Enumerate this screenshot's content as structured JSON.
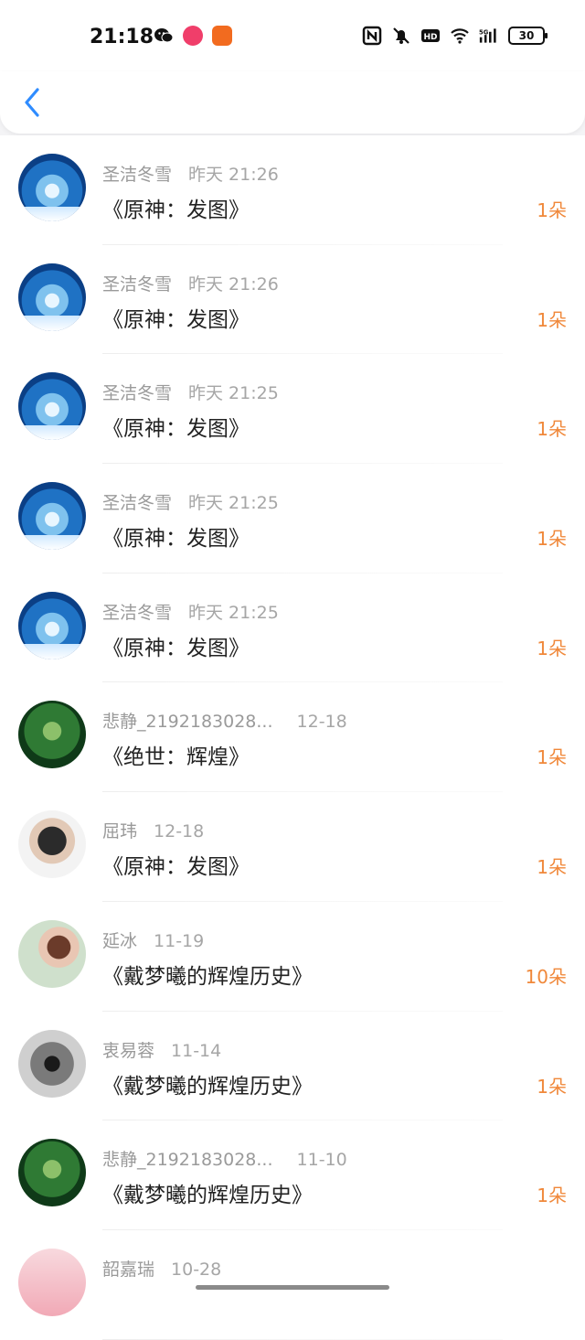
{
  "status_bar": {
    "time": "21:18",
    "app_icons": [
      "wechat-icon",
      "social-app-icon",
      "video-app-icon"
    ],
    "system_icons": [
      "nfc-icon",
      "mute-icon",
      "hd-icon",
      "wifi-icon",
      "5g-signal-icon"
    ],
    "battery": "30"
  },
  "header": {
    "back_icon": "chevron-left-icon"
  },
  "colors": {
    "accent": "#2f8cff",
    "count": "#f0883a",
    "meta": "#9a9a9a",
    "title": "#222222"
  },
  "items": [
    {
      "name": "圣洁冬雪",
      "date": "昨天 21:26",
      "title": "《原神：发图》",
      "count": "1朵",
      "avatar": "snow-avatar"
    },
    {
      "name": "圣洁冬雪",
      "date": "昨天 21:26",
      "title": "《原神：发图》",
      "count": "1朵",
      "avatar": "snow-avatar"
    },
    {
      "name": "圣洁冬雪",
      "date": "昨天 21:25",
      "title": "《原神：发图》",
      "count": "1朵",
      "avatar": "snow-avatar"
    },
    {
      "name": "圣洁冬雪",
      "date": "昨天 21:25",
      "title": "《原神：发图》",
      "count": "1朵",
      "avatar": "snow-avatar"
    },
    {
      "name": "圣洁冬雪",
      "date": "昨天 21:25",
      "title": "《原神：发图》",
      "count": "1朵",
      "avatar": "snow-avatar"
    },
    {
      "name": "悲静_2192183028...",
      "date": "12-18",
      "title": "《绝世：辉煌》",
      "count": "1朵",
      "avatar": "leaf-avatar"
    },
    {
      "name": "屈玮",
      "date": "12-18",
      "title": "《原神：发图》",
      "count": "1朵",
      "avatar": "person-avatar"
    },
    {
      "name": "延冰",
      "date": "11-19",
      "title": "《戴梦曦的辉煌历史》",
      "count": "10朵",
      "avatar": "girl-avatar"
    },
    {
      "name": "衷易蓉",
      "date": "11-14",
      "title": "《戴梦曦的辉煌历史》",
      "count": "1朵",
      "avatar": "gray-avatar"
    },
    {
      "name": "悲静_2192183028...",
      "date": "11-10",
      "title": "《戴梦曦的辉煌历史》",
      "count": "1朵",
      "avatar": "leaf-avatar"
    },
    {
      "name": "韶嘉瑞",
      "date": "10-28",
      "title": "",
      "count": "",
      "avatar": "pink-avatar"
    }
  ]
}
